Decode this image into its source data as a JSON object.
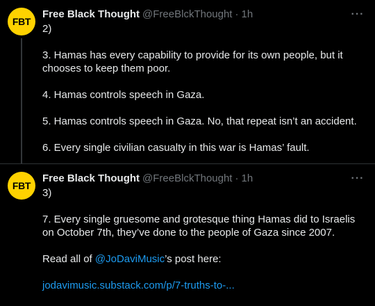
{
  "tweets": [
    {
      "avatar_text": "FBT",
      "name": "Free Black Thought",
      "handle": "@FreeBlckThought",
      "separator": "·",
      "time": "1h",
      "more_icon": "more-horizontal-icon",
      "lines": [
        "2)",
        "3. Hamas has every capability to provide for its own people, but it chooses to keep them poor.",
        "4. Hamas controls speech in Gaza.",
        "5. Hamas controls speech in Gaza. No, that repeat isn’t an accident.",
        "6. Every single civilian casualty in this war is Hamas’ fault."
      ]
    },
    {
      "avatar_text": "FBT",
      "name": "Free Black Thought",
      "handle": "@FreeBlckThought",
      "separator": "·",
      "time": "1h",
      "more_icon": "more-horizontal-icon",
      "lines": [
        "3)",
        "7. Every single gruesome and grotesque thing Hamas did to Israelis on October 7th, they’ve done to the people of Gaza since 2007."
      ],
      "read_prefix": "Read all of ",
      "mention": "@JoDaviMusic",
      "read_suffix": "’s post here:",
      "link": "jodavimusic.substack.com/p/7-truths-to-..."
    }
  ],
  "colors": {
    "background": "#000000",
    "text": "#e7e9ea",
    "secondary": "#71767b",
    "accent": "#1d9bf0",
    "avatar_bg": "#ffd200"
  }
}
